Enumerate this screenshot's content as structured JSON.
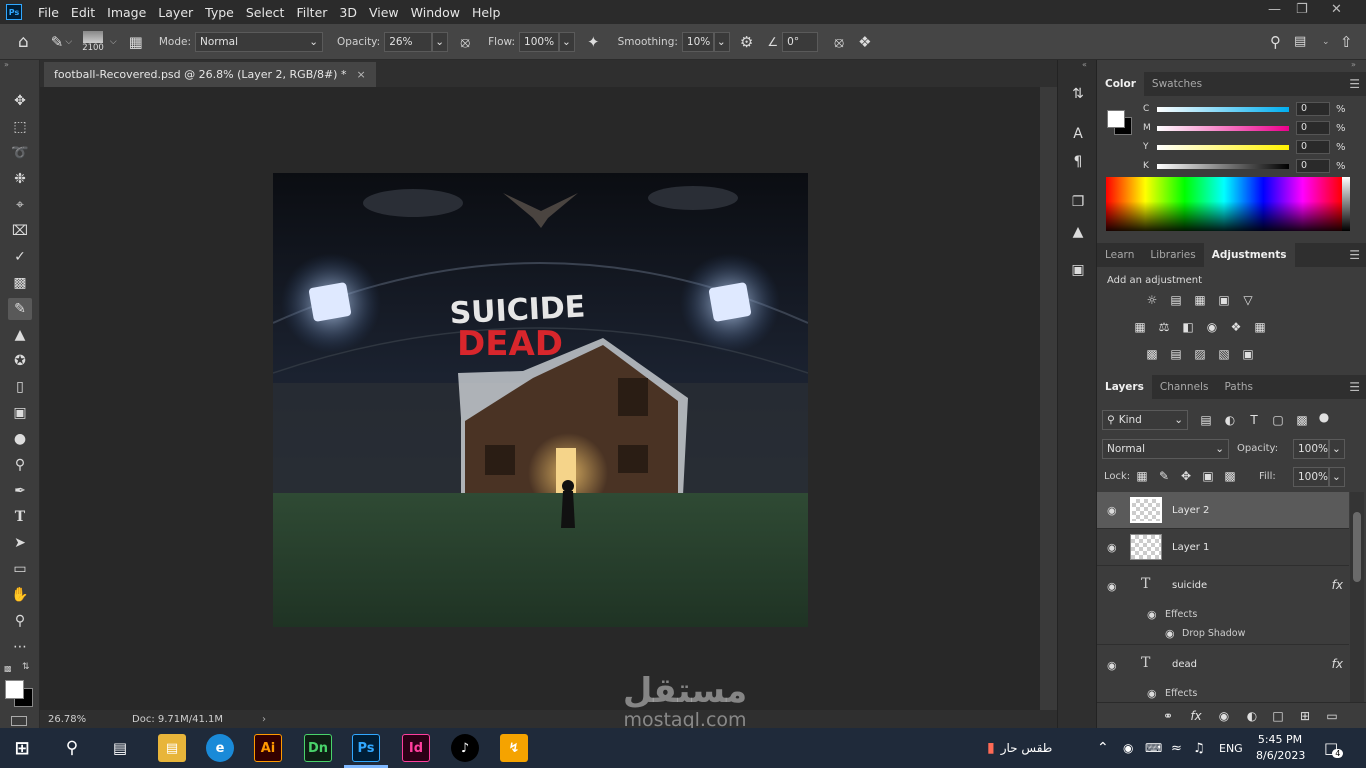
{
  "menubar": {
    "app_logo": "Ps",
    "items": [
      "File",
      "Edit",
      "Image",
      "Layer",
      "Type",
      "Select",
      "Filter",
      "3D",
      "View",
      "Window",
      "Help"
    ],
    "controls": [
      "minimize-icon",
      "restore-icon",
      "close-icon"
    ]
  },
  "options": {
    "brush_size": "2100",
    "mode_label": "Mode:",
    "mode_value": "Normal",
    "opacity_label": "Opacity:",
    "opacity_value": "26%",
    "flow_label": "Flow:",
    "flow_value": "100%",
    "smoothing_label": "Smoothing:",
    "smoothing_value": "10%",
    "angle_value": "0°"
  },
  "document": {
    "tab_title": "football-Recovered.psd @ 26.8% (Layer 2, RGB/8#) *",
    "zoom": "26.78%",
    "doc_info": "Doc: 9.71M/41.1M"
  },
  "artwork": {
    "title_line1": "SUICIDE",
    "title_line2": "DEAD"
  },
  "color_panel": {
    "tabs": [
      "Color",
      "Swatches"
    ],
    "active_tab": "Color",
    "sliders": [
      {
        "label": "C",
        "value": "0",
        "unit": "%"
      },
      {
        "label": "M",
        "value": "0",
        "unit": "%"
      },
      {
        "label": "Y",
        "value": "0",
        "unit": "%"
      },
      {
        "label": "K",
        "value": "0",
        "unit": "%"
      }
    ]
  },
  "adjustments_panel": {
    "tabs": [
      "Learn",
      "Libraries",
      "Adjustments"
    ],
    "active_tab": "Adjustments",
    "hint": "Add an adjustment"
  },
  "layers_panel": {
    "tabs": [
      "Layers",
      "Channels",
      "Paths"
    ],
    "active_tab": "Layers",
    "filter_kind": "Kind",
    "blend_mode": "Normal",
    "opacity_label": "Opacity:",
    "opacity_value": "100%",
    "lock_label": "Lock:",
    "fill_label": "Fill:",
    "fill_value": "100%",
    "layers": [
      {
        "name": "Layer 2",
        "type": "pixel",
        "selected": true
      },
      {
        "name": "Layer 1",
        "type": "pixel",
        "selected": false
      },
      {
        "name": "suicide",
        "type": "text",
        "effects_label": "Effects",
        "effect": "Drop Shadow"
      },
      {
        "name": "dead",
        "type": "text",
        "effects_label": "Effects"
      }
    ]
  },
  "taskbar": {
    "weather": "طقس حار",
    "language": "ENG",
    "time": "5:45 PM",
    "date": "8/6/2023",
    "notifications": "4",
    "apps": [
      "Ai",
      "Dn",
      "Ps",
      "Id"
    ]
  },
  "watermark": {
    "arabic": "مستقل",
    "latin": "mostaql.com"
  }
}
